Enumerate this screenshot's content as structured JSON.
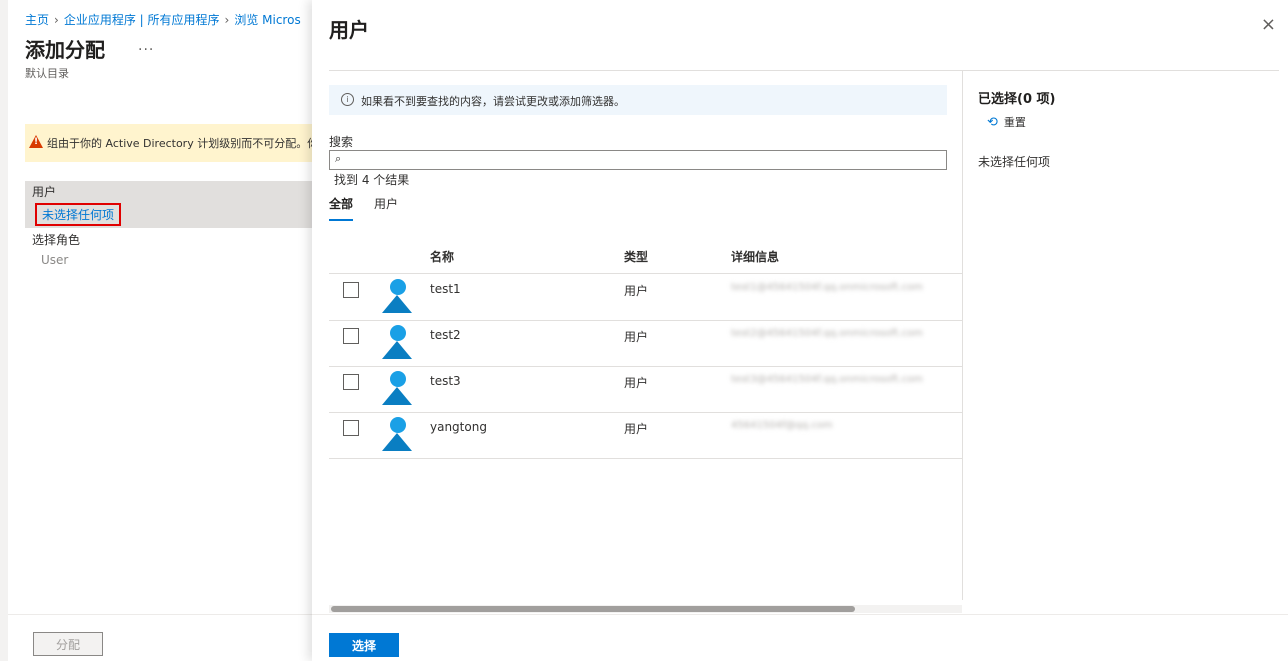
{
  "left": {
    "breadcrumb": [
      "主页",
      "企业应用程序 | 所有应用程序",
      "浏览 Micros"
    ],
    "title": "添加分配",
    "more": "...",
    "subtitle": "默认目录",
    "warning": "组由于你的 Active Directory 计划级别而不可分配。你",
    "users_label": "用户",
    "users_value": "未选择任何项",
    "role_label": "选择角色",
    "role_value": "User",
    "assign_button": "分配"
  },
  "panel": {
    "title": "用户",
    "close": "×",
    "info": "如果看不到要查找的内容，请尝试更改或添加筛选器。",
    "search_label": "搜索",
    "search_placeholder": "",
    "results": "找到 4 个结果",
    "tabs": [
      "全部",
      "用户"
    ],
    "columns": [
      "名称",
      "类型",
      "详细信息"
    ],
    "rows": [
      {
        "name": "test1",
        "type": "用户",
        "detail": "test1@45641504f.qq.onmicrosoft.com"
      },
      {
        "name": "test2",
        "type": "用户",
        "detail": "test2@45641504f.qq.onmicrosoft.com"
      },
      {
        "name": "test3",
        "type": "用户",
        "detail": "test3@45641504f.qq.onmicrosoft.com"
      },
      {
        "name": "yangtong",
        "type": "用户",
        "detail": "45641504f@qq.com"
      }
    ],
    "select_button": "选择",
    "selected_title": "已选择(0 项)",
    "reset": "重置",
    "selected_none": "未选择任何项"
  },
  "colors": {
    "accent": "#0078d4",
    "warning": "#d83b01",
    "highlight": "#e00000"
  }
}
